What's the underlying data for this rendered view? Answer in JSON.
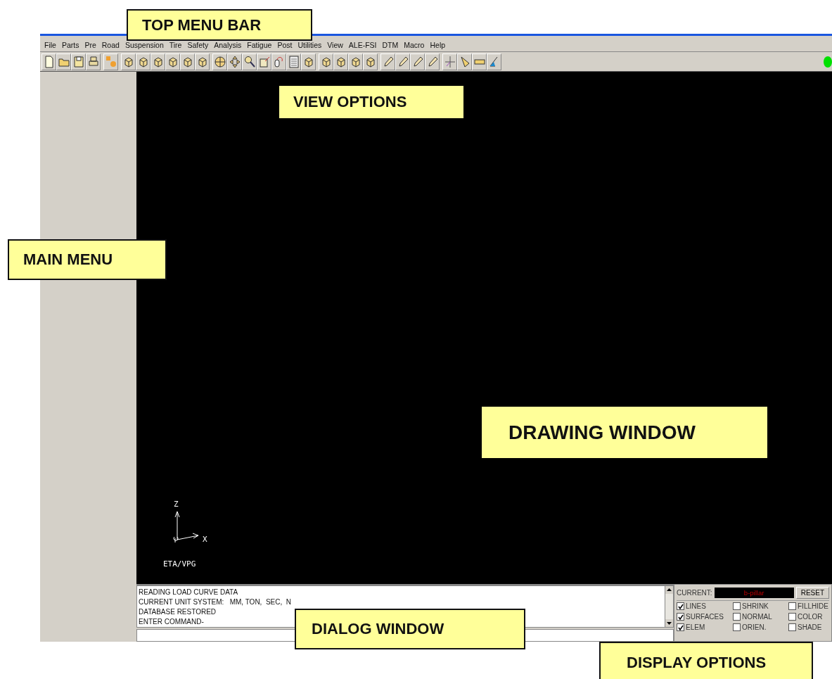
{
  "menu_bar": [
    "File",
    "Parts",
    "Pre",
    "Road",
    "Suspension",
    "Tire",
    "Safety",
    "Analysis",
    "Fatigue",
    "Post",
    "Utilities",
    "View",
    "ALE-FSI",
    "DTM",
    "Macro",
    "Help"
  ],
  "drawing_window": {
    "axis_z": "Z",
    "axis_x": "X",
    "logo_text": "ETA/VPG"
  },
  "dialog": {
    "lines": [
      "READING LOAD CURVE DATA",
      "CURRENT UNIT SYSTEM:   MM, TON,  SEC,  N",
      "DATABASE RESTORED",
      "ENTER COMMAND-"
    ]
  },
  "display_options": {
    "current_label": "CURRENT:",
    "current_value": "b-pillar",
    "reset": "RESET",
    "options": [
      {
        "label": "LINES",
        "checked": true
      },
      {
        "label": "SHRINK",
        "checked": false
      },
      {
        "label": "FILLHIDE",
        "checked": false
      },
      {
        "label": "SURFACES",
        "checked": true
      },
      {
        "label": "NORMAL",
        "checked": false
      },
      {
        "label": "COLOR",
        "checked": false
      },
      {
        "label": "ELEM",
        "checked": true
      },
      {
        "label": "ORIEN.",
        "checked": false
      },
      {
        "label": "SHADE",
        "checked": false
      }
    ]
  },
  "callouts": [
    {
      "text": "TOP MENU BAR",
      "kind": "top-menu"
    },
    {
      "text": "VIEW OPTIONS",
      "kind": "view"
    },
    {
      "text": "MAIN MENU",
      "kind": "main-menu"
    },
    {
      "text": "DRAWING WINDOW",
      "kind": "drawing"
    },
    {
      "text": "DIALOG WINDOW",
      "kind": "dialog"
    },
    {
      "text": "DISPLAY OPTIONS",
      "kind": "display"
    }
  ]
}
